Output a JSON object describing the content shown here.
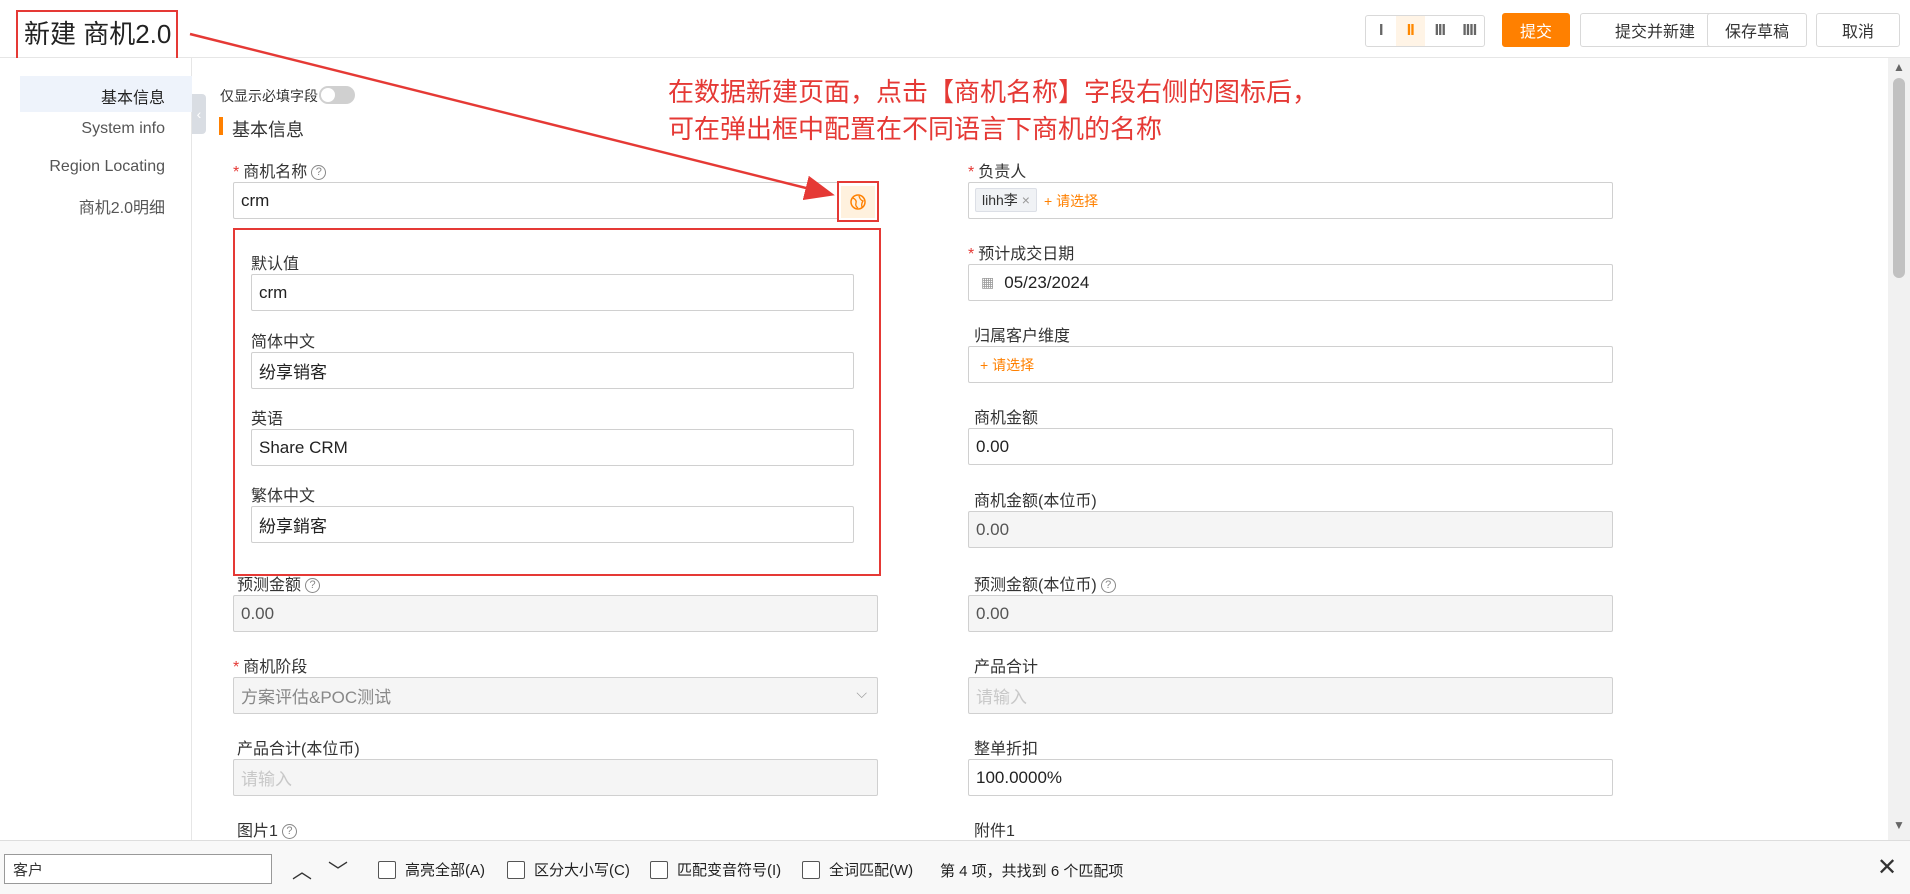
{
  "header": {
    "title": "新建 商机2.0",
    "layout_options": [
      "I",
      "II",
      "III",
      "IIII"
    ],
    "submit": "提交",
    "submit_new": "提交并新建",
    "save_draft": "保存草稿",
    "cancel": "取消"
  },
  "sidebar": {
    "items": [
      "基本信息",
      "System info",
      "Region Locating",
      "商机2.0明细"
    ]
  },
  "main": {
    "required_only": "仅显示必填字段",
    "section_title": "基本信息",
    "fields": {
      "opportunity_name_label": "商机名称",
      "opportunity_name_value": "crm",
      "owner_label": "负责人",
      "owner_tag": "lihh李",
      "owner_add": "+ 请选择",
      "close_date_label": "预计成交日期",
      "close_date_value": "05/23/2024",
      "account_dim_label": "归属客户维度",
      "account_dim_add": "+ 请选择",
      "amount_label": "商机金额",
      "amount_value": "0.00",
      "amount_local_label": "商机金额(本位币)",
      "amount_local_value": "0.00",
      "forecast_label": "预测金额",
      "forecast_value": "0.00",
      "forecast_local_label": "预测金额(本位币)",
      "forecast_local_value": "0.00",
      "stage_label": "商机阶段",
      "stage_value": "方案评估&POC测试",
      "product_total_label": "产品合计",
      "product_total_ph": "请输入",
      "product_total_local_label": "产品合计(本位币)",
      "product_total_local_ph": "请输入",
      "discount_label": "整单折扣",
      "discount_value": "100.0000%",
      "image_label": "图片1",
      "attachment_label": "附件1"
    }
  },
  "popup": {
    "default_label": "默认值",
    "default_value": "crm",
    "zh_cn_label": "简体中文",
    "zh_cn_value": "纷享销客",
    "en_label": "英语",
    "en_value": "Share CRM",
    "zh_tw_label": "繁体中文",
    "zh_tw_value": "紛享銷客"
  },
  "annotation": {
    "line1": "在数据新建页面，点击【商机名称】字段右侧的图标后，",
    "line2": "可在弹出框中配置在不同语言下商机的名称"
  },
  "findbar": {
    "query": "客户",
    "highlight_all": "高亮全部(A)",
    "match_case": "区分大小写(C)",
    "match_diacritics": "匹配变音符号(I)",
    "whole_words": "全词匹配(W)",
    "result": "第 4 项，共找到 6 个匹配项"
  },
  "colors": {
    "accent": "#ff8000",
    "annotation": "#e53935",
    "active_nav_bg": "#eef3fb"
  }
}
